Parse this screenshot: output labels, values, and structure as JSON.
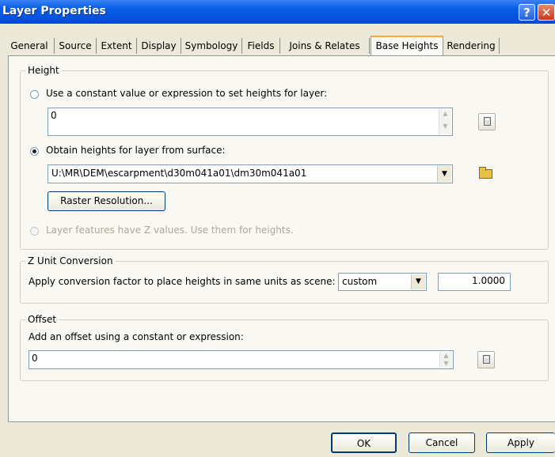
{
  "window": {
    "title": "Layer Properties",
    "help_label": "?",
    "close_label": "✕"
  },
  "tabs": [
    {
      "label": "General"
    },
    {
      "label": "Source"
    },
    {
      "label": "Extent"
    },
    {
      "label": "Display"
    },
    {
      "label": "Symbology"
    },
    {
      "label": "Fields"
    },
    {
      "label": "Joins & Relates"
    },
    {
      "label": "Base Heights",
      "active": true
    },
    {
      "label": "Rendering"
    }
  ],
  "height_group": {
    "legend": "Height",
    "constant_option": {
      "label": "Use a constant value or expression to set heights for layer:",
      "checked": false
    },
    "constant_value": "0",
    "surface_option": {
      "label": "Obtain heights for layer from surface:",
      "checked": true
    },
    "surface_path": "U:\\MR\\DEM\\escarpment\\d30m041a01\\dm30m041a01",
    "raster_resolution_label": "Raster Resolution...",
    "z_values_option": {
      "label": "Layer features have Z values.  Use them for heights.",
      "enabled": false
    }
  },
  "z_unit_group": {
    "legend": "Z Unit Conversion",
    "description": "Apply conversion factor to place heights in same units as scene:",
    "unit_value": "custom",
    "factor_value": "1.0000"
  },
  "offset_group": {
    "legend": "Offset",
    "description": "Add an offset using a constant or expression:",
    "offset_value": "0"
  },
  "footer": {
    "ok_label": "OK",
    "cancel_label": "Cancel",
    "apply_label": "Apply"
  }
}
